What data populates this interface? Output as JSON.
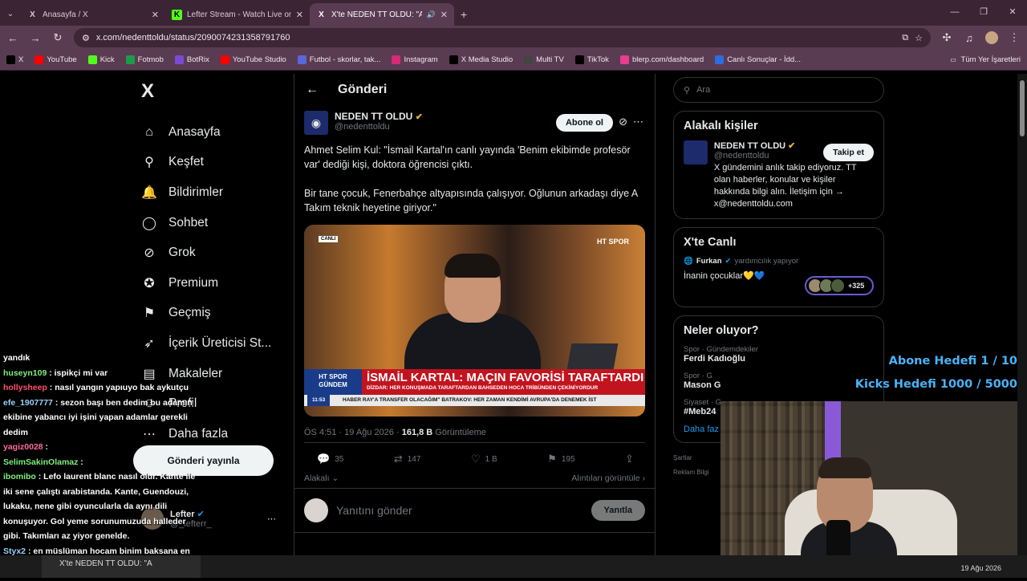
{
  "browser": {
    "tabs": [
      {
        "icon": "X",
        "title": "Anasayfa / X",
        "active": false
      },
      {
        "icon": "K",
        "title": "Lefter Stream - Watch Live on K",
        "active": false
      },
      {
        "icon": "X",
        "title": "X'te NEDEN TT OLDU: \"Ahı",
        "active": true
      }
    ],
    "new_tab": "+",
    "url": "x.com/nedenttoldu/status/2090074231358791760",
    "bookmarks": [
      {
        "label": "X",
        "color": "#000000"
      },
      {
        "label": "YouTube",
        "color": "#ff0000"
      },
      {
        "label": "Kick",
        "color": "#53fc18"
      },
      {
        "label": "Fotmob",
        "color": "#1d9b47"
      },
      {
        "label": "BotRix",
        "color": "#7a4bd1"
      },
      {
        "label": "YouTube Studio",
        "color": "#ff0000"
      },
      {
        "label": "Futbol - skorlar, tak...",
        "color": "#5a67d8"
      },
      {
        "label": "Instagram",
        "color": "#d62976"
      },
      {
        "label": "X Media Studio",
        "color": "#000000"
      },
      {
        "label": "Multi TV",
        "color": "#444444"
      },
      {
        "label": "TikTok",
        "color": "#000000"
      },
      {
        "label": "blerp.com/dashboard",
        "color": "#e83e8c"
      },
      {
        "label": "Canlı Sonuçlar - İdd...",
        "color": "#2d6cdf"
      }
    ],
    "bookmarks_all": "Tüm Yer İşaretleri"
  },
  "sidebar": {
    "logo": "X",
    "items": [
      {
        "label": "Anasayfa",
        "icon": "home-icon",
        "glyph": "⌂"
      },
      {
        "label": "Keşfet",
        "icon": "search-icon",
        "glyph": "⚲"
      },
      {
        "label": "Bildirimler",
        "icon": "bell-icon",
        "glyph": "🔔"
      },
      {
        "label": "Sohbet",
        "icon": "chat-icon",
        "glyph": "◯"
      },
      {
        "label": "Grok",
        "icon": "grok-icon",
        "glyph": "⊘"
      },
      {
        "label": "Premium",
        "icon": "premium-icon",
        "glyph": "✪"
      },
      {
        "label": "Geçmiş",
        "icon": "bookmark-icon",
        "glyph": "⚑"
      },
      {
        "label": "İçerik Üreticisi St...",
        "icon": "rocket-icon",
        "glyph": "➶"
      },
      {
        "label": "Makaleler",
        "icon": "article-icon",
        "glyph": "▤"
      },
      {
        "label": "Profil",
        "icon": "profile-icon",
        "glyph": "☺"
      },
      {
        "label": "Daha fazla",
        "icon": "more-icon",
        "glyph": "⋯"
      }
    ],
    "post_button": "Gönderi yayınla",
    "account": {
      "name": "Lefter",
      "handle": "@_lefterr_"
    }
  },
  "post": {
    "header": "Gönderi",
    "author_name": "NEDEN TT OLDU",
    "author_handle": "@nedenttoldu",
    "subscribe": "Abone ol",
    "text": "Ahmet Selim Kul: \"İsmail Kartal'ın canlı yayında 'Benim ekibimde profesör var' dediği kişi, doktora öğrencisi çıktı.\n\nBir tane çocuk, Fenerbahçe altyapısında çalışıyor. Oğlunun arkadaşı diye A Takım teknik heyetine giriyor.\"",
    "media": {
      "live_tag": "CANLI",
      "channel": "HT SPOR",
      "ticker_tag": "HT SPOR GÜNDEM",
      "headline": "İSMAİL KARTAL: MAÇIN FAVORİSİ TARAFTARDI",
      "subline": "DİZDAR: HER KONUŞMADA TARAFTARDAN BAHSEDEN HOCA TRİBÜNDEN ÇEKİNİYORDUR",
      "time": "11:53",
      "crawl": "HABER  RAY'A TRANSFER OLACAĞIM\"   BATRAKOV: HER ZAMAN KENDİMİ AVRUPA'DA DENEMEK İST"
    },
    "timestamp": "ÖS 4:51 · 19 Ağu 2026 · ",
    "views": "161,8 B",
    "views_label": "Görüntüleme",
    "stats": {
      "replies": "35",
      "reposts": "147",
      "likes": "1 B",
      "bookmarks": "195"
    },
    "sort_label": "Alakalı",
    "sort_right": "Alıntıları görüntüle",
    "reply_placeholder": "Yanıtını gönder",
    "reply_button": "Yanıtla"
  },
  "right": {
    "search_placeholder": "Ara",
    "relevant_title": "Alakalı kişiler",
    "relevant_name": "NEDEN TT OLDU",
    "relevant_handle": "@nedenttoldu",
    "relevant_bio": "X gündemini anlık takip ediyoruz. TT olan haberler, konular ve kişiler hakkında bilgi alın. İletişim için → x@nedenttoldu.com",
    "follow_button": "Takip et",
    "live_title": "X'te Canlı",
    "live_user": "Furkan",
    "live_activity": "yardımcılık yapıyor",
    "live_text": "İnanin çocuklar💛💙",
    "live_count": "+325",
    "trends_title": "Neler oluyor?",
    "trends": [
      {
        "category": "Spor · Gündemdekiler",
        "title": "Ferdi Kadıoğlu"
      },
      {
        "category": "Spor · G",
        "title": "Mason G"
      },
      {
        "category": "Siyaset · G",
        "title": "#Meb24"
      }
    ],
    "show_more": "Daha faz",
    "footer1": "Şartlar",
    "footer2": "Reklam Bilgi"
  },
  "overlay": {
    "goal1": "Abone Hedefi 1 / 10",
    "goal2": "Kicks Hedefi 1000 / 5000",
    "chat": [
      {
        "user": "",
        "msg": "yandık"
      },
      {
        "user": "huseyn109",
        "msg": " : ispikçi mi var"
      },
      {
        "user": "hollysheep",
        "msg": " : nasıl yangın yapıuyo bak aykutçu"
      },
      {
        "user": "efe_1907777",
        "msg": " : sezon başı ben dedim bu adamın ekibine yabancı iyi işini yapan adamlar gerekli dedim"
      },
      {
        "user": "yagiz0028",
        "msg": " : "
      },
      {
        "user": "SelimSakinOlamaz",
        "msg": " : "
      },
      {
        "user": "ibomibo",
        "msg": " : Lefo laurent blanc nasıl olur. Kante ile iki sene çalıştı arabistanda. Kante, Guendouzi, lukaku, nene gibi oyuncularla da aynı dili konuşuyor. Gol yeme sorunumuzuda halleder gibi. Takımları az yiyor genelde."
      },
      {
        "user": "Styx2",
        "msg": " : en müslüman hocam binim baksana en müslümanım diyenden korkacaksın"
      }
    ]
  },
  "taskbar": {
    "window": "X'te NEDEN TT OLDU: \"A",
    "date": "19 Ağu 2026"
  }
}
